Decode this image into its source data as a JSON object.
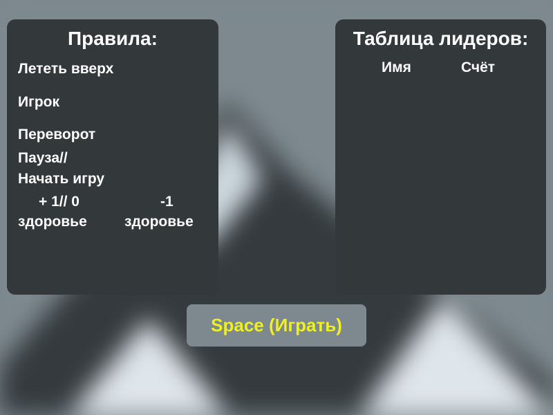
{
  "colors": {
    "background": "#7d898f",
    "panel": "#33383b",
    "text": "#ffffff",
    "play_button_text": "#f0f020"
  },
  "rules": {
    "title": "Правила:",
    "fly_up": "Лететь вверх",
    "player": "Игрок",
    "flip": "Переворот",
    "pause": "Пауза//",
    "start_game": "Начать игру",
    "health_plus_value": "+ 1// 0",
    "health_plus_label": "здоровье",
    "health_minus_value": "-1",
    "health_minus_label": "здоровье"
  },
  "leaderboard": {
    "title": "Таблица лидеров:",
    "columns": [
      "Имя",
      "Счёт"
    ],
    "rows": []
  },
  "play_button": {
    "label": "Space (Играть)"
  }
}
